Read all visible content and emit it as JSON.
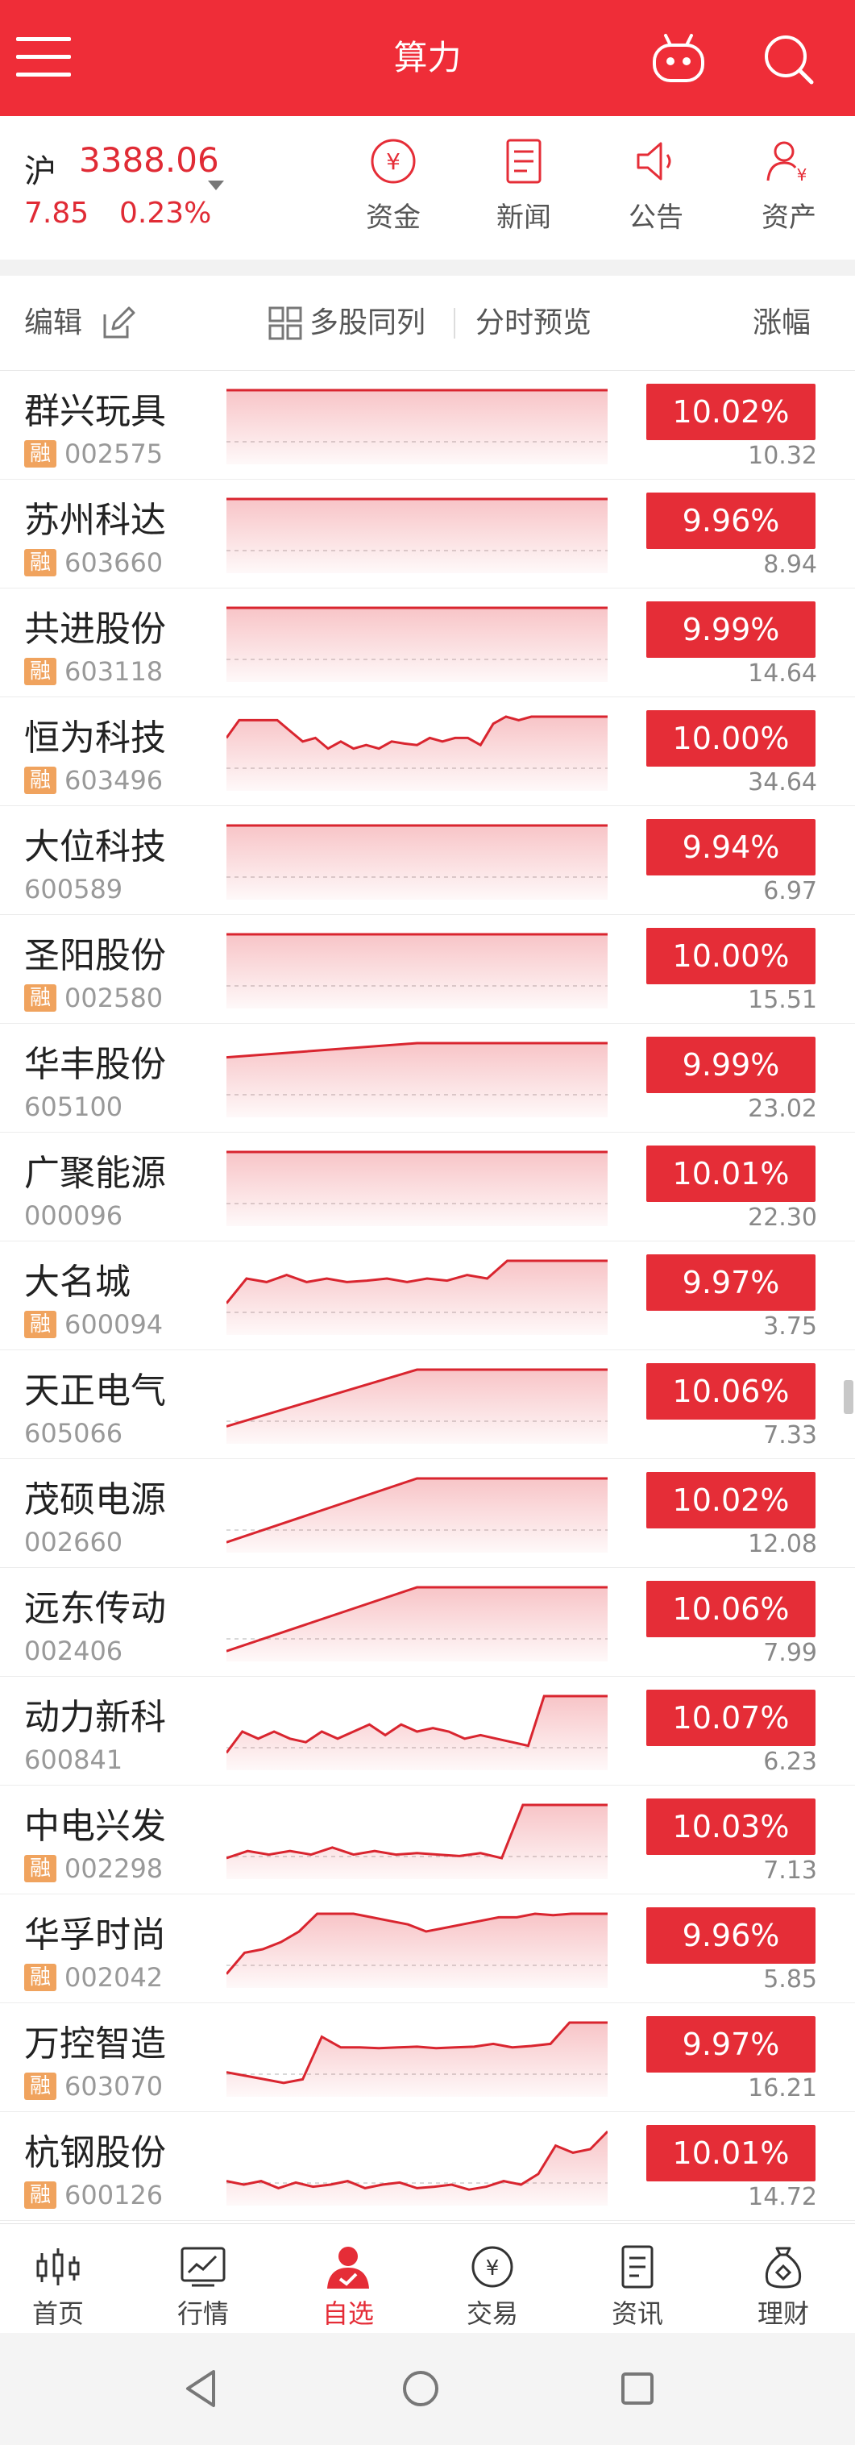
{
  "header": {
    "title": "算力",
    "menu_icon": "hamburger-icon",
    "robot_icon": "robot-icon",
    "search_icon": "search-icon"
  },
  "index": {
    "name": "沪",
    "value": "3388.06",
    "change": "7.85",
    "change_pct": "0.23%"
  },
  "quick_actions": [
    {
      "label": "资金",
      "icon": "yuan-circle-icon"
    },
    {
      "label": "新闻",
      "icon": "news-icon"
    },
    {
      "label": "公告",
      "icon": "speaker-icon"
    },
    {
      "label": "资产",
      "icon": "user-asset-icon"
    }
  ],
  "toolbar": {
    "edit": "编辑",
    "multi": "多股同列",
    "preview": "分时预览",
    "sort": "涨幅"
  },
  "colors": {
    "brand": "#ef2d38",
    "up": "#e52d37",
    "rong_badge": "#f0a35e"
  },
  "rong_label": "融",
  "stocks": [
    {
      "name": "群兴玩具",
      "code": "002575",
      "rong": true,
      "pct": "10.02%",
      "price": "10.32",
      "spark": [
        0.0,
        0.0
      ]
    },
    {
      "name": "苏州科达",
      "code": "603660",
      "rong": true,
      "pct": "9.96%",
      "price": "8.94",
      "spark": [
        0.0,
        0.0
      ]
    },
    {
      "name": "共进股份",
      "code": "603118",
      "rong": true,
      "pct": "9.99%",
      "price": "14.64",
      "spark": [
        0.0,
        0.0
      ]
    },
    {
      "name": "恒为科技",
      "code": "603496",
      "rong": true,
      "pct": "10.00%",
      "price": "34.64",
      "spark": [
        0.3,
        0.05,
        0.05,
        0.05,
        0.05,
        0.2,
        0.35,
        0.3,
        0.45,
        0.35,
        0.45,
        0.4,
        0.45,
        0.35,
        0.38,
        0.4,
        0.3,
        0.35,
        0.3,
        0.3,
        0.4,
        0.1,
        0.0,
        0.05,
        0.0,
        0.0,
        0.0,
        0.0,
        0.0,
        0.0,
        0.0
      ]
    },
    {
      "name": "大位科技",
      "code": "600589",
      "rong": false,
      "pct": "9.94%",
      "price": "6.97",
      "spark": [
        0.0,
        0.0
      ]
    },
    {
      "name": "圣阳股份",
      "code": "002580",
      "rong": true,
      "pct": "10.00%",
      "price": "15.51",
      "spark": [
        0.0,
        0.0
      ]
    },
    {
      "name": "华丰股份",
      "code": "605100",
      "rong": false,
      "pct": "9.99%",
      "price": "23.02",
      "spark": [
        0.2,
        0.0,
        0.0
      ]
    },
    {
      "name": "广聚能源",
      "code": "000096",
      "rong": false,
      "pct": "10.01%",
      "price": "22.30",
      "spark": [
        0.0,
        0.0
      ]
    },
    {
      "name": "大名城",
      "code": "600094",
      "rong": true,
      "pct": "9.97%",
      "price": "3.75",
      "spark": [
        0.6,
        0.25,
        0.3,
        0.2,
        0.3,
        0.25,
        0.3,
        0.28,
        0.25,
        0.3,
        0.25,
        0.28,
        0.2,
        0.25,
        0.0,
        0.0,
        0.0,
        0.0,
        0.0,
        0.0
      ]
    },
    {
      "name": "天正电气",
      "code": "605066",
      "rong": false,
      "pct": "10.06%",
      "price": "7.33",
      "spark": [
        0.8,
        0.0,
        0.0
      ]
    },
    {
      "name": "茂硕电源",
      "code": "002660",
      "rong": false,
      "pct": "10.02%",
      "price": "12.08",
      "spark": [
        0.9,
        0.0,
        0.0
      ]
    },
    {
      "name": "远东传动",
      "code": "002406",
      "rong": false,
      "pct": "10.06%",
      "price": "7.99",
      "spark": [
        0.9,
        0.0,
        0.0
      ]
    },
    {
      "name": "动力新科",
      "code": "600841",
      "rong": false,
      "pct": "10.07%",
      "price": "6.23",
      "spark": [
        0.8,
        0.5,
        0.6,
        0.5,
        0.6,
        0.65,
        0.5,
        0.6,
        0.5,
        0.4,
        0.55,
        0.4,
        0.5,
        0.45,
        0.5,
        0.6,
        0.55,
        0.6,
        0.65,
        0.7,
        0.0,
        0.0,
        0.0,
        0.0,
        0.0
      ]
    },
    {
      "name": "中电兴发",
      "code": "002298",
      "rong": true,
      "pct": "10.03%",
      "price": "7.13",
      "spark": [
        0.75,
        0.65,
        0.7,
        0.65,
        0.7,
        0.6,
        0.7,
        0.65,
        0.7,
        0.68,
        0.7,
        0.72,
        0.68,
        0.75,
        0.0,
        0.0,
        0.0,
        0.0,
        0.0
      ]
    },
    {
      "name": "华孚时尚",
      "code": "002042",
      "rong": true,
      "pct": "9.96%",
      "price": "5.85",
      "spark": [
        0.85,
        0.55,
        0.5,
        0.4,
        0.25,
        0.0,
        0.0,
        0.0,
        0.05,
        0.1,
        0.15,
        0.25,
        0.2,
        0.15,
        0.1,
        0.05,
        0.05,
        0.0,
        0.02,
        0.0,
        0.0,
        0.0
      ]
    },
    {
      "name": "万控智造",
      "code": "603070",
      "rong": true,
      "pct": "9.97%",
      "price": "16.21",
      "spark": [
        0.7,
        0.75,
        0.8,
        0.85,
        0.8,
        0.2,
        0.35,
        0.35,
        0.36,
        0.35,
        0.34,
        0.36,
        0.35,
        0.34,
        0.3,
        0.35,
        0.33,
        0.3,
        0.0,
        0.0,
        0.0
      ]
    },
    {
      "name": "杭钢股份",
      "code": "600126",
      "rong": true,
      "pct": "10.01%",
      "price": "14.72",
      "spark": [
        0.7,
        0.75,
        0.7,
        0.8,
        0.72,
        0.78,
        0.75,
        0.7,
        0.8,
        0.75,
        0.72,
        0.8,
        0.78,
        0.75,
        0.82,
        0.78,
        0.7,
        0.75,
        0.6,
        0.2,
        0.3,
        0.25,
        0.0
      ]
    }
  ],
  "bottom_nav": [
    {
      "label": "首页",
      "icon": "candlestick-icon"
    },
    {
      "label": "行情",
      "icon": "chart-line-icon"
    },
    {
      "label": "自选",
      "icon": "user-check-icon",
      "active": true
    },
    {
      "label": "交易",
      "icon": "yuan-circle-icon"
    },
    {
      "label": "资讯",
      "icon": "document-icon"
    },
    {
      "label": "理财",
      "icon": "money-bag-icon"
    }
  ],
  "system_nav": {
    "back_icon": "back-triangle-icon",
    "home_icon": "home-circle-icon",
    "recent_icon": "recent-square-icon"
  }
}
